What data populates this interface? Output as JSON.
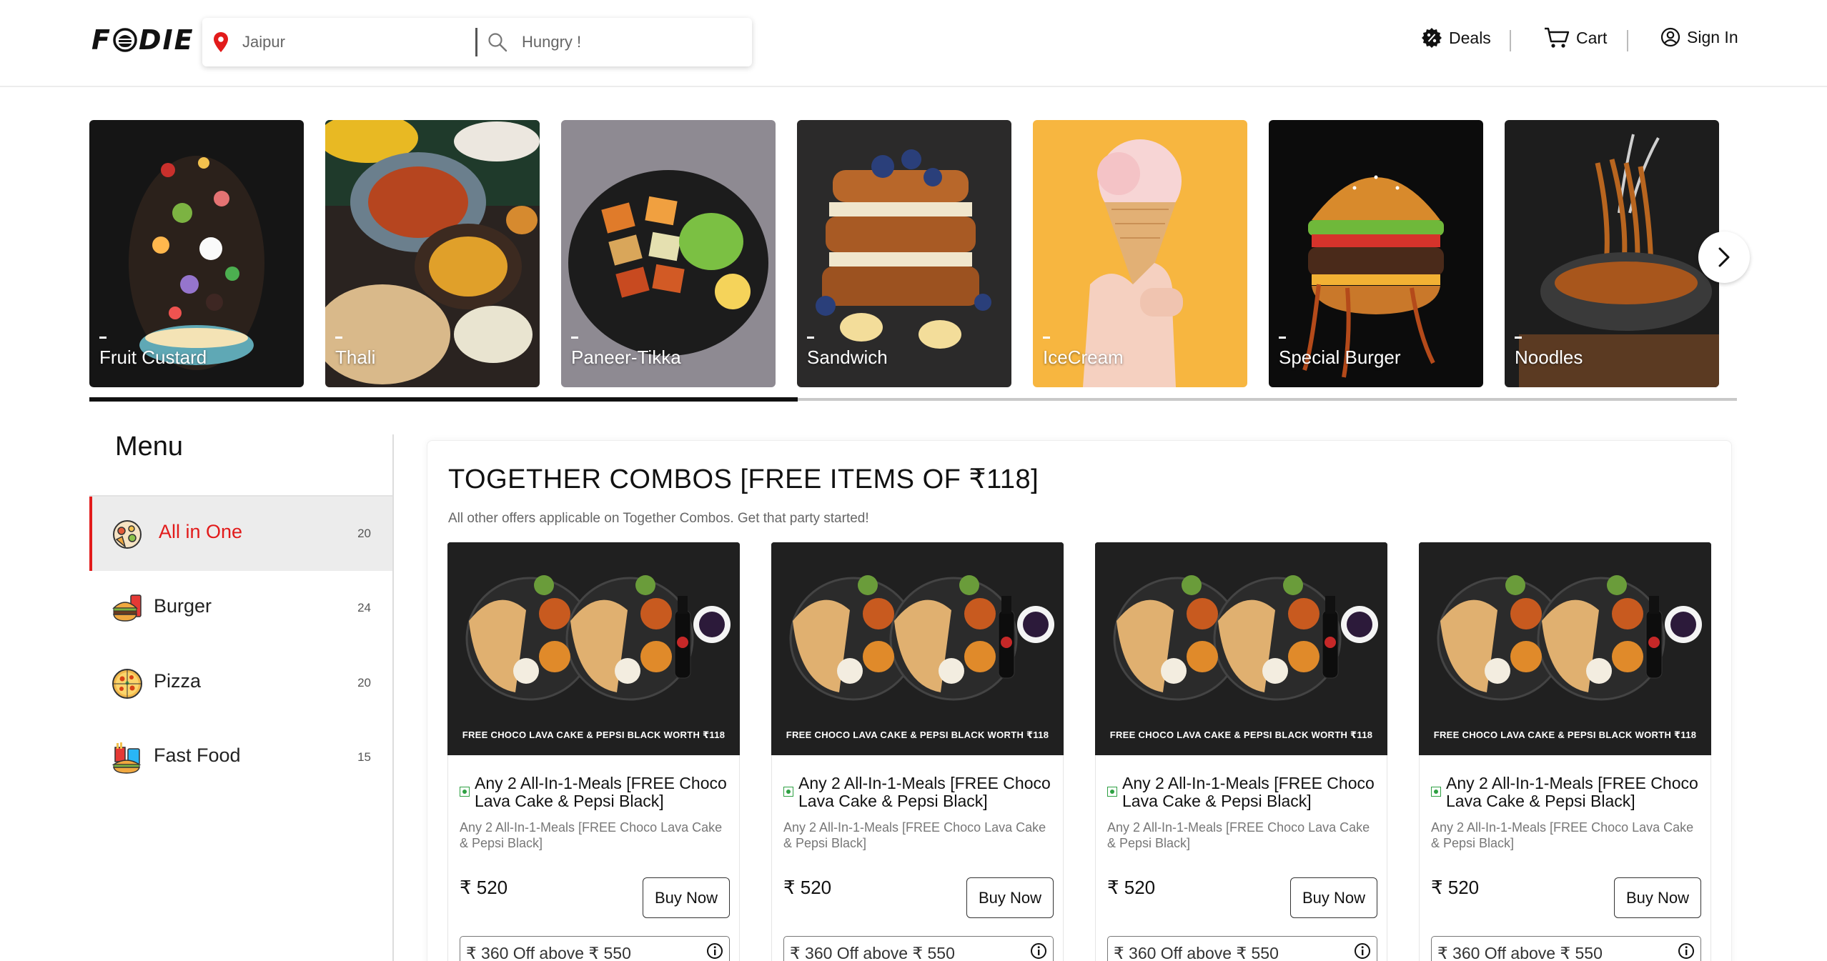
{
  "header": {
    "logo": "F DIE",
    "location_value": "Jaipur",
    "search_placeholder": "Hungry !",
    "nav": {
      "deals": "Deals",
      "cart": "Cart",
      "sign_in": "Sign In"
    }
  },
  "categories": [
    {
      "label": "Fruit Custard",
      "bg": "#1a1a1a"
    },
    {
      "label": "Thali",
      "bg": "#2a2320"
    },
    {
      "label": "Paneer-Tikka",
      "bg": "#8e8a92"
    },
    {
      "label": "Sandwich",
      "bg": "#2b2a2a"
    },
    {
      "label": "IceCream",
      "bg": "#f7b640"
    },
    {
      "label": "Special Burger",
      "bg": "#0c0c0c"
    },
    {
      "label": "Noodles",
      "bg": "#1d1d1d"
    }
  ],
  "carousel_progress": 0.43,
  "menu": {
    "title": "Menu",
    "items": [
      {
        "label": "All in One",
        "count": "20",
        "icon": "all-in-one-icon"
      },
      {
        "label": "Burger",
        "count": "24",
        "icon": "burger-icon"
      },
      {
        "label": "Pizza",
        "count": "20",
        "icon": "pizza-icon"
      },
      {
        "label": "Fast Food",
        "count": "15",
        "icon": "fast-food-icon"
      }
    ]
  },
  "section": {
    "title": "TOGETHER COMBOS [FREE ITEMS OF ₹118]",
    "subtitle": "All other offers applicable on Together Combos. Get that party started!"
  },
  "products": [
    {
      "banner": "FREE CHOCO LAVA CAKE & PEPSI BLACK WORTH ₹118",
      "name": "Any 2 All-In-1-Meals [FREE Choco Lava Cake & Pepsi Black]",
      "desc": "Any 2 All-In-1-Meals [FREE Choco Lava Cake & Pepsi Black]",
      "price": "₹ 520",
      "buy_label": "Buy Now",
      "offer": "₹ 360 Off above ₹ 550"
    },
    {
      "banner": "FREE CHOCO LAVA CAKE & PEPSI BLACK WORTH ₹118",
      "name": "Any 2 All-In-1-Meals [FREE Choco Lava Cake & Pepsi Black]",
      "desc": "Any 2 All-In-1-Meals [FREE Choco Lava Cake & Pepsi Black]",
      "price": "₹ 520",
      "buy_label": "Buy Now",
      "offer": "₹ 360 Off above ₹ 550"
    },
    {
      "banner": "FREE CHOCO LAVA CAKE & PEPSI BLACK WORTH ₹118",
      "name": "Any 2 All-In-1-Meals [FREE Choco Lava Cake & Pepsi Black]",
      "desc": "Any 2 All-In-1-Meals [FREE Choco Lava Cake & Pepsi Black]",
      "price": "₹ 520",
      "buy_label": "Buy Now",
      "offer": "₹ 360 Off above ₹ 550"
    },
    {
      "banner": "FREE CHOCO LAVA CAKE & PEPSI BLACK WORTH ₹118",
      "name": "Any 2 All-In-1-Meals [FREE Choco Lava Cake & Pepsi Black]",
      "desc": "Any 2 All-In-1-Meals [FREE Choco Lava Cake & Pepsi Black]",
      "price": "₹ 520",
      "buy_label": "Buy Now",
      "offer": "₹ 360 Off above ₹ 550"
    }
  ],
  "colors": {
    "accent": "#e21b1b",
    "veg": "#2ea043"
  }
}
